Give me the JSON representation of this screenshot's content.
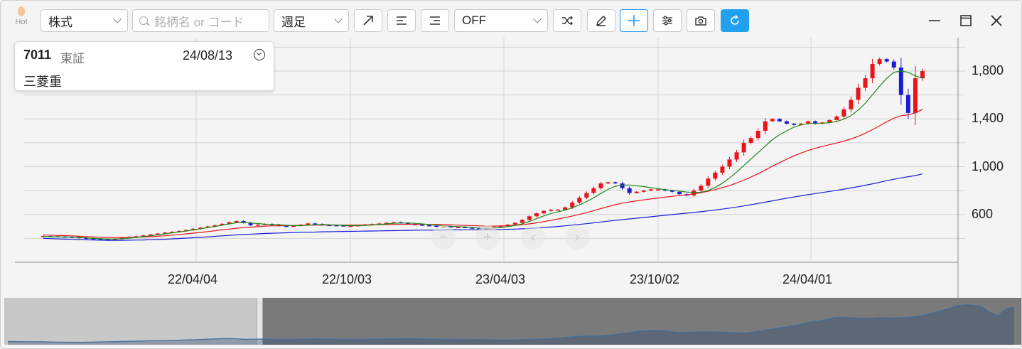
{
  "toolbar": {
    "hot_label": "Hot",
    "asset_type": "株式",
    "search_placeholder": "銘柄名 or コード",
    "period": "週足",
    "indicator": "OFF"
  },
  "stock": {
    "code": "7011",
    "market": "東証",
    "date": "24/08/13",
    "name": "三菱重"
  },
  "colors": {
    "up": "#e8151b",
    "down": "#1b1bd6",
    "ma_short": "#1a8a1a",
    "ma_mid": "#e8151b",
    "ma_long": "#1b1bd6",
    "accent": "#22a0f0"
  },
  "chart_data": {
    "type": "candlestick",
    "interval": "weekly",
    "x_ticks": [
      "22/04/04",
      "22/10/03",
      "23/04/03",
      "23/10/02",
      "24/04/01"
    ],
    "y_ticks": [
      600,
      1000,
      1400,
      1800
    ],
    "ylim": [
      200,
      2050
    ],
    "grid": true,
    "series": {
      "close": [
        420,
        418,
        415,
        413,
        410,
        405,
        400,
        395,
        392,
        390,
        395,
        405,
        412,
        418,
        425,
        432,
        440,
        448,
        455,
        462,
        470,
        480,
        490,
        500,
        510,
        522,
        535,
        545,
        530,
        510,
        515,
        520,
        515,
        505,
        500,
        505,
        515,
        525,
        520,
        512,
        510,
        508,
        505,
        505,
        510,
        515,
        520,
        525,
        530,
        535,
        530,
        520,
        515,
        510,
        505,
        500,
        500,
        495,
        495,
        490,
        485,
        480,
        485,
        495,
        505,
        515,
        530,
        555,
        585,
        610,
        630,
        640,
        640,
        660,
        700,
        740,
        780,
        820,
        860,
        870,
        860,
        820,
        780,
        790,
        800,
        810,
        810,
        800,
        790,
        770,
        760,
        800,
        840,
        900,
        950,
        1000,
        1060,
        1120,
        1200,
        1240,
        1300,
        1380,
        1400,
        1380,
        1360,
        1350,
        1360,
        1380,
        1360,
        1370,
        1390,
        1420,
        1480,
        1560,
        1660,
        1740,
        1860,
        1900,
        1880,
        1830,
        1600,
        1450,
        1740,
        1800
      ],
      "ma_short": [
        415,
        414,
        413,
        412,
        410,
        408,
        404,
        400,
        397,
        394,
        394,
        397,
        402,
        408,
        415,
        422,
        430,
        438,
        446,
        454,
        462,
        471,
        480,
        490,
        500,
        511,
        521,
        531,
        533,
        529,
        524,
        519,
        517,
        514,
        510,
        507,
        507,
        510,
        514,
        515,
        514,
        512,
        509,
        507,
        507,
        509,
        512,
        516,
        521,
        526,
        529,
        529,
        526,
        521,
        515,
        510,
        505,
        501,
        498,
        495,
        491,
        487,
        485,
        487,
        491,
        498,
        508,
        522,
        542,
        565,
        588,
        608,
        622,
        636,
        656,
        680,
        708,
        740,
        776,
        810,
        836,
        846,
        846,
        840,
        834,
        824,
        816,
        808,
        802,
        796,
        788,
        784,
        786,
        800,
        826,
        862,
        906,
        954,
        1010,
        1064,
        1118,
        1172,
        1226,
        1268,
        1300,
        1330,
        1350,
        1362,
        1362,
        1364,
        1368,
        1378,
        1398,
        1428,
        1474,
        1530,
        1602,
        1674,
        1740,
        1790,
        1800,
        1790,
        1760,
        1740
      ],
      "ma_mid": [
        428,
        427,
        425,
        423,
        421,
        418,
        415,
        412,
        410,
        408,
        407,
        407,
        408,
        410,
        412,
        415,
        418,
        422,
        427,
        432,
        438,
        444,
        450,
        457,
        464,
        471,
        478,
        485,
        490,
        494,
        498,
        502,
        505,
        506,
        507,
        508,
        509,
        510,
        511,
        512,
        512,
        512,
        512,
        512,
        512,
        513,
        514,
        515,
        516,
        517,
        518,
        518,
        518,
        518,
        517,
        516,
        515,
        513,
        511,
        509,
        507,
        505,
        503,
        503,
        504,
        506,
        509,
        514,
        521,
        530,
        540,
        551,
        562,
        574,
        587,
        601,
        616,
        632,
        649,
        666,
        682,
        695,
        705,
        714,
        722,
        730,
        738,
        745,
        752,
        758,
        764,
        772,
        782,
        794,
        808,
        824,
        842,
        863,
        887,
        913,
        941,
        972,
        1004,
        1034,
        1063,
        1090,
        1114,
        1136,
        1154,
        1170,
        1184,
        1198,
        1214,
        1232,
        1254,
        1280,
        1310,
        1343,
        1376,
        1406,
        1426,
        1434,
        1450,
        1480
      ],
      "ma_long": [
        400,
        398,
        396,
        394,
        392,
        390,
        388,
        386,
        385,
        384,
        384,
        384,
        385,
        386,
        387,
        389,
        391,
        393,
        396,
        399,
        402,
        405,
        409,
        413,
        417,
        421,
        425,
        429,
        432,
        435,
        438,
        441,
        443,
        445,
        447,
        449,
        451,
        452,
        453,
        455,
        456,
        457,
        458,
        459,
        460,
        461,
        462,
        463,
        464,
        465,
        466,
        467,
        468,
        469,
        469,
        470,
        470,
        471,
        471,
        472,
        472,
        472,
        473,
        474,
        475,
        476,
        478,
        480,
        483,
        487,
        491,
        495,
        500,
        505,
        511,
        517,
        523,
        530,
        537,
        544,
        551,
        557,
        563,
        569,
        575,
        581,
        587,
        593,
        599,
        605,
        611,
        617,
        623,
        630,
        637,
        645,
        653,
        662,
        672,
        682,
        692,
        703,
        714,
        725,
        736,
        746,
        756,
        766,
        775,
        784,
        793,
        802,
        812,
        822,
        833,
        845,
        857,
        870,
        883,
        895,
        906,
        916,
        926,
        940
      ]
    }
  }
}
